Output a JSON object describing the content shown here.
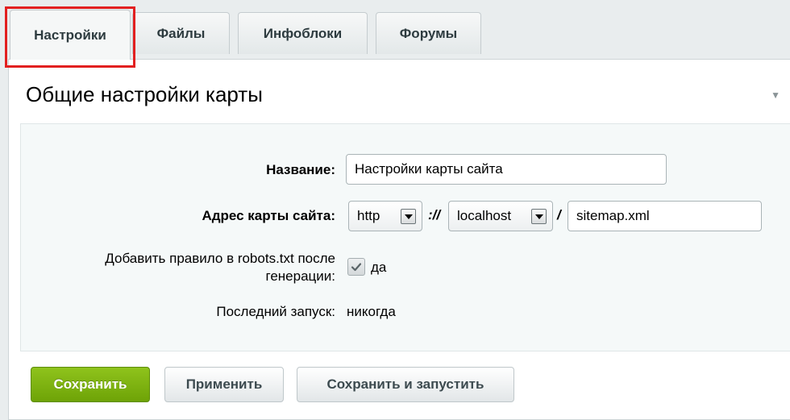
{
  "tabs": [
    {
      "label": "Настройки",
      "active": true
    },
    {
      "label": "Файлы"
    },
    {
      "label": "Инфоблоки"
    },
    {
      "label": "Форумы"
    }
  ],
  "panel": {
    "title": "Общие настройки карты"
  },
  "form": {
    "name_label": "Название:",
    "name_value": "Настройки карты сайта",
    "address_label": "Адрес карты сайта:",
    "protocol_value": "http",
    "scheme_separator": "://",
    "host_value": "localhost",
    "path_separator": "/",
    "file_value": "sitemap.xml",
    "robots_label_line1": "Добавить правило в robots.txt после",
    "robots_label_line2": "генерации:",
    "robots_checked": true,
    "robots_option": "да",
    "last_run_label": "Последний запуск:",
    "last_run_value": "никогда"
  },
  "buttons": {
    "save": "Сохранить",
    "apply": "Применить",
    "save_run": "Сохранить и запустить"
  },
  "colors": {
    "highlight": "#e22020",
    "save_button": "#7ab311"
  },
  "icons": {
    "dropdown": "triangle-down",
    "check": "checkmark",
    "collapse": "chevron-down"
  }
}
